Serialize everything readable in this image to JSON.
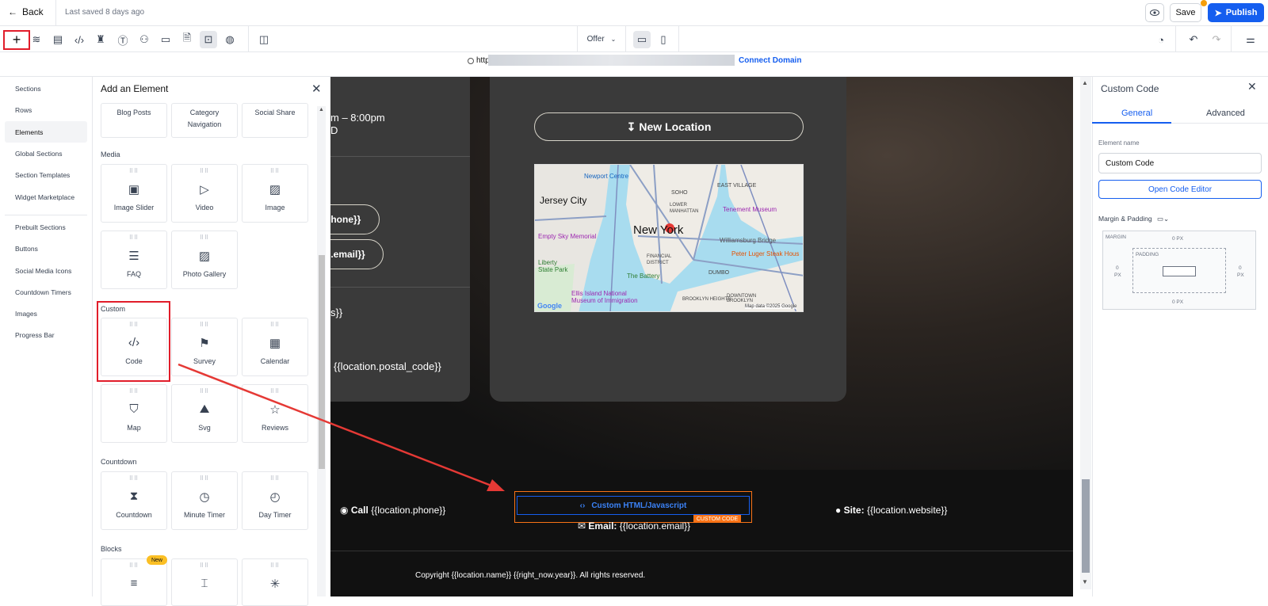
{
  "topbar": {
    "back_label": "Back",
    "saved_text": "Last saved 8 days ago",
    "save_label": "Save",
    "publish_label": "Publish"
  },
  "toolbar": {
    "page_select": "Offer",
    "add_icon": "plus-icon"
  },
  "urlbar": {
    "url_prefix": "http",
    "connect_label": "Connect Domain"
  },
  "leftnav": {
    "items": [
      "Sections",
      "Rows",
      "Elements",
      "Global Sections",
      "Section Templates",
      "Widget Marketplace",
      "Prebuilt Sections",
      "Buttons",
      "Social Media Icons",
      "Countdown Timers",
      "Images",
      "Progress Bar"
    ],
    "active": "Elements"
  },
  "panel": {
    "title": "Add an Element",
    "top_cards": [
      "Blog Posts",
      "Category Navigation",
      "Social Share"
    ],
    "media_label": "Media",
    "media": [
      "Image Slider",
      "Video",
      "Image",
      "FAQ",
      "Photo Gallery"
    ],
    "custom_label": "Custom",
    "custom": [
      "Code",
      "Survey",
      "Calendar",
      "Map",
      "Svg",
      "Reviews"
    ],
    "countdown_label": "Countdown",
    "countdown": [
      "Countdown",
      "Minute Timer",
      "Day Timer"
    ],
    "blocks_label": "Blocks",
    "new_badge": "New"
  },
  "canvas": {
    "hours_line1": "m – 8:00pm",
    "hours_line2": "D",
    "new_location": "New Location",
    "phone_pill": "phone}}",
    "email_pill": "n.email}}",
    "postal": "{{location.postal_code}}",
    "frag_s": "s}}",
    "map_labels": {
      "jersey": "Jersey City",
      "newyork": "New York",
      "soho": "SOHO",
      "eastvillage": "EAST VILLAGE",
      "lower": "LOWER MANHATTAN",
      "financial": "FINANCIAL DISTRICT",
      "battery": "The Battery",
      "dumbo": "DUMBO",
      "tenement": "Tenement Museum",
      "williamsburg": "Williamsburg Bridge",
      "peter": "Peter Luger Steak Hous",
      "empty": "Empty Sky Memorial",
      "liberty": "Liberty State Park",
      "ellis": "Ellis Island National Museum of Immigration",
      "newport": "Newport Centre",
      "brooklyn": "BROOKLYN HEIGHTS",
      "downtown": "DOWNTOWN BROOKLYN",
      "google": "Google",
      "mapdata": "Map data ©2025 Google"
    },
    "call_label": "Call",
    "call_value": "{{location.phone}}",
    "email_label": "Email:",
    "email_value": "{{location.email}}",
    "site_label": "Site:",
    "site_value": "{{location.website}}",
    "custom_code_label": "Custom HTML/Javascript",
    "custom_code_tag": "CUSTOM CODE",
    "copyright": "Copyright {{location.name}} {{right_now.year}}. All rights reserved."
  },
  "rpanel": {
    "title": "Custom Code",
    "tabs": [
      "General",
      "Advanced"
    ],
    "active_tab": "General",
    "element_name_label": "Element name",
    "element_name_value": "Custom Code",
    "open_editor": "Open Code Editor",
    "margin_padding": "Margin & Padding",
    "margin_label": "MARGIN",
    "padding_label": "PADDING",
    "margin_top": "0 PX",
    "margin_bottom": "0 PX",
    "margin_left": "0",
    "margin_right": "0",
    "px": "PX"
  },
  "colors": {
    "accent": "#155eef",
    "highlight": "#e11d2a",
    "code_frame": "#f97316"
  }
}
